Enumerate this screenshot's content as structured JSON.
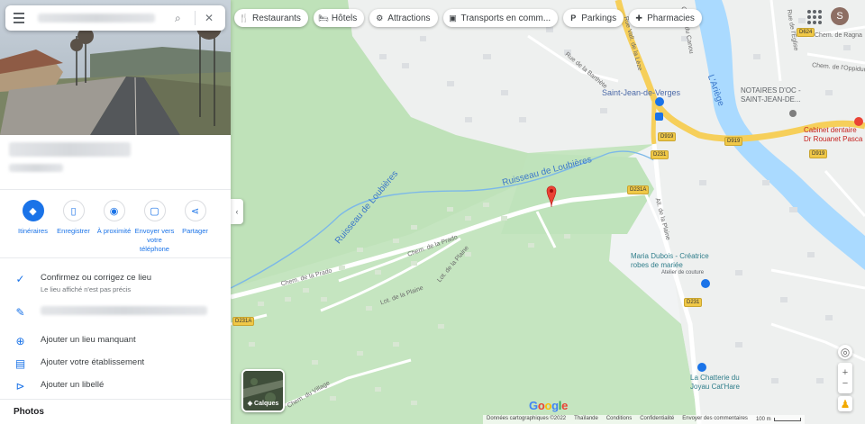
{
  "search": {
    "query": ""
  },
  "place": {
    "actions": [
      {
        "label": "Itinéraires",
        "icon": "directions-icon"
      },
      {
        "label": "Enregistrer",
        "icon": "bookmark-icon"
      },
      {
        "label": "À proximité",
        "icon": "nearby-icon"
      },
      {
        "label": "Envoyer vers votre téléphone",
        "icon": "send-to-phone-icon"
      },
      {
        "label": "Partager",
        "icon": "share-icon"
      }
    ],
    "confirm": {
      "title": "Confirmez ou corrigez ce lieu",
      "subtitle": "Le lieu affiché n'est pas précis"
    },
    "add_missing": "Ajouter un lieu manquant",
    "add_business": "Ajouter votre établissement",
    "add_label": "Ajouter un libellé",
    "photos_heading": "Photos"
  },
  "chips": [
    {
      "label": "Restaurants",
      "icon": "restaurant-icon"
    },
    {
      "label": "Hôtels",
      "icon": "hotel-icon"
    },
    {
      "label": "Attractions",
      "icon": "attractions-icon"
    },
    {
      "label": "Transports en comm...",
      "icon": "transit-icon"
    },
    {
      "label": "Parkings",
      "icon": "parking-icon"
    },
    {
      "label": "Pharmacies",
      "icon": "pharmacy-icon"
    }
  ],
  "user": {
    "initial": "S"
  },
  "map": {
    "labels": {
      "stream1": "Ruisseau de Loubières",
      "stream2": "Ruisseau de Loubières",
      "river": "L'Ariège",
      "town": "Saint-Jean-de-Verges",
      "notaires": "NOTAIRES D'OC -\nSAINT-JEAN-DE...",
      "cabinet": "Cabinet dentaire\nDr Rouanet Pasca",
      "maria": "Maria Dubois - Créatrice\nrobes de mariée",
      "maria_sub": "Atelier de couture",
      "chatterie": "La Chatterie du\nJoyau Cat'Hare",
      "road_vall": "Rue Vall. de la Lèze",
      "road_plaine": "All. de la Plaine",
      "road_prado1": "Chem. de la Prado",
      "road_prado2": "Chem. de la Prado",
      "road_lot": "Lot. de la Plaine",
      "road_lot2": "Lot. de la Plaine",
      "road_barthete": "Rue de la Barthète",
      "road_village": "Chem. du Village",
      "road_eglise": "Rue de l'Église",
      "road_canou": "Chem. du Canou",
      "road_oppidum": "Chem. de l'Oppidum",
      "road_ragna": "Chem. de Ragna"
    },
    "shields": [
      "D919",
      "D919",
      "D919",
      "D231",
      "D231A",
      "D231",
      "D231A",
      "D624"
    ],
    "layers_label": "Calques",
    "google": "Google",
    "footer": [
      "Données cartographiques ©2022",
      "Thaïlande",
      "Conditions",
      "Confidentialité",
      "Envoyer des commentaires"
    ],
    "scale": "100 m"
  },
  "colors": {
    "accent": "#1a73e8",
    "green": "#a8d5a2",
    "water": "#aadaff",
    "yellow_road": "#f6cf5a",
    "pin": "#ea4335"
  }
}
